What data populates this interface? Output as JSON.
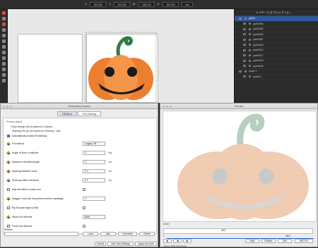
{
  "inkscape": {
    "toolbar": {
      "x_label": "X:",
      "x_value": "200.000",
      "y_label": "Y:",
      "y_value": "200.000",
      "w_label": "W:",
      "w_value": "108.143",
      "h_label": "H:",
      "h_value": "200.000",
      "unit": "mm"
    },
    "objects_panel": {
      "title": "レイヤーとオブジェクト(L)",
      "rows": [
        {
          "label": "g3111",
          "selected": true
        },
        {
          "label": "path3094",
          "selected": false
        },
        {
          "label": "path3062",
          "selected": false
        },
        {
          "label": "path3060",
          "selected": false
        },
        {
          "label": "path3087",
          "selected": false
        },
        {
          "label": "path3010",
          "selected": false
        },
        {
          "label": "path3014",
          "selected": false
        },
        {
          "label": "path3017",
          "selected": false
        },
        {
          "label": "path3016",
          "selected": false
        },
        {
          "label": "path3015",
          "selected": false
        },
        {
          "label": "Layer 1",
          "selected": false
        },
        {
          "label": "path111",
          "selected": false
        }
      ]
    }
  },
  "params": {
    "title": "Embroidery Params",
    "tabs": [
      "Fill/Stitch",
      "Fill Underlay"
    ],
    "pane_heading": "Preview objects",
    "note_line1": "These settings will be applied to 8 objects.",
    "note_line2": "- Disabling this tab will disable the following 7 tabs.",
    "auto_fill": "Automatically routed fill stitching",
    "rows": [
      {
        "label": "Fill method",
        "value": "Legacy Fill",
        "unit": "",
        "kind": "combo"
      },
      {
        "label": "Angle of lines of stitches",
        "value": "0",
        "unit": "deg",
        "kind": "field"
      },
      {
        "label": "Maximum fill stitch length",
        "value": "3",
        "unit": "mm",
        "kind": "field"
      },
      {
        "label": "Spacing between rows",
        "value": "0.4",
        "unit": "mm",
        "kind": "field"
      },
      {
        "label": "Running stitch tolerance",
        "value": "0.2",
        "unit": "mm",
        "kind": "field"
      },
      {
        "label": "Skip last stitch in each row",
        "value": "",
        "unit": "",
        "kind": "check"
      },
      {
        "label": "Stagger rows this many times before repeating",
        "value": "4",
        "unit": "",
        "kind": "field"
      },
      {
        "label": "Flip fill (start right-to-left)",
        "value": "",
        "unit": "",
        "kind": "check"
      },
      {
        "label": "Allow lock stitches",
        "value": "Both",
        "unit": "",
        "kind": "combo"
      },
      {
        "label": "Force lock stitches",
        "value": "",
        "unit": "",
        "kind": "check"
      }
    ],
    "presets_label": "Presets",
    "preset_buttons": [
      "Load",
      "Add",
      "Overwrite",
      "Delete"
    ],
    "bottom_buttons": [
      "Cancel",
      "Use Last Settings",
      "Apply and Quit"
    ]
  },
  "preview": {
    "title": "Preview",
    "scale": "8 mm",
    "current": "5827",
    "total": "5827",
    "start": "1",
    "buttons": [
      "Start",
      "Restart",
      "Quit"
    ],
    "status": "Speed: 1000 stitches/sec",
    "stitch_label": "5827/10"
  },
  "colors": {
    "pumpkin_orange": "#f08a3a",
    "stem_green": "#2f7a45",
    "selection_blue": "#2d5a9e"
  }
}
